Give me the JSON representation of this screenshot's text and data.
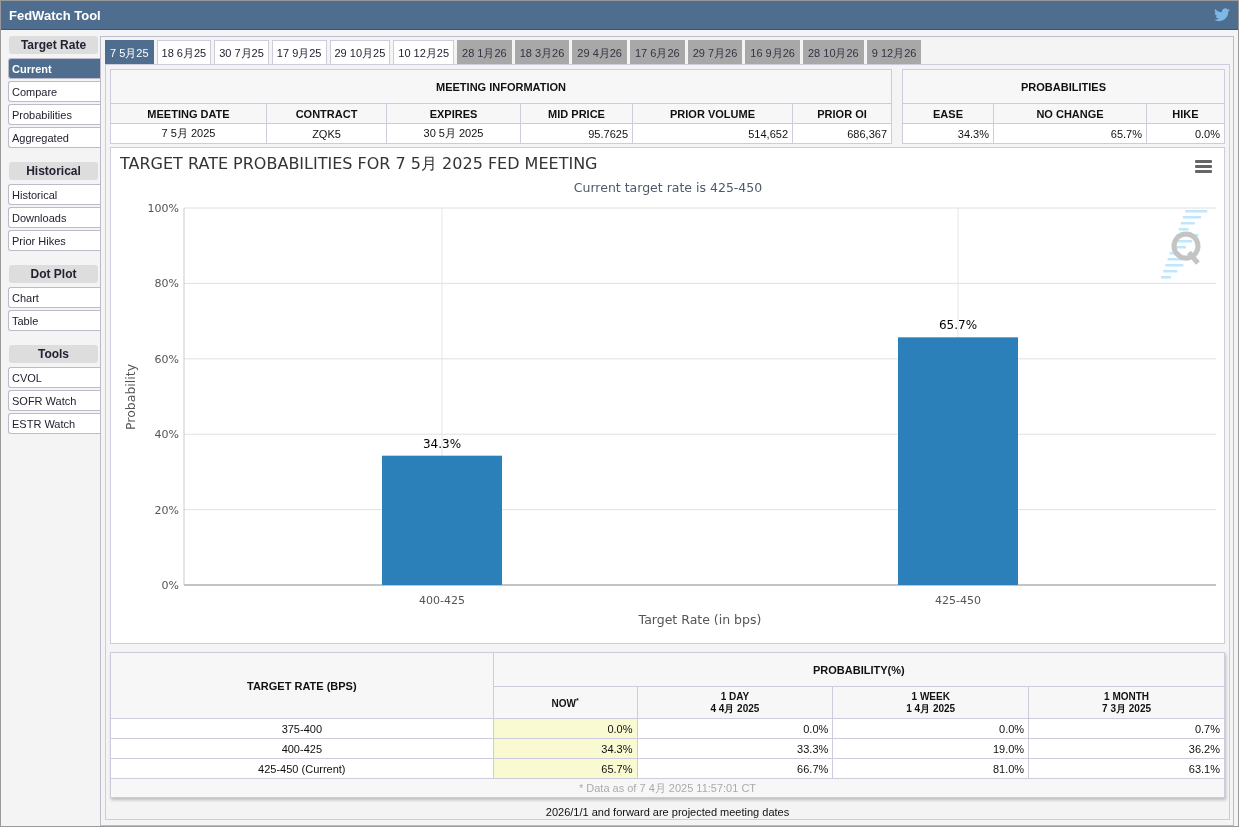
{
  "window": {
    "title": "FedWatch Tool"
  },
  "sidebar": [
    {
      "heading": "Target Rate",
      "items": [
        {
          "label": "Current",
          "selected": true
        },
        {
          "label": "Compare",
          "selected": false
        },
        {
          "label": "Probabilities",
          "selected": false
        },
        {
          "label": "Aggregated",
          "selected": false
        }
      ]
    },
    {
      "heading": "Historical",
      "items": [
        {
          "label": "Historical",
          "selected": false
        },
        {
          "label": "Downloads",
          "selected": false
        },
        {
          "label": "Prior Hikes",
          "selected": false
        }
      ]
    },
    {
      "heading": "Dot Plot",
      "items": [
        {
          "label": "Chart",
          "selected": false
        },
        {
          "label": "Table",
          "selected": false
        }
      ]
    },
    {
      "heading": "Tools",
      "items": [
        {
          "label": "CVOL",
          "selected": false
        },
        {
          "label": "SOFR Watch",
          "selected": false
        },
        {
          "label": "ESTR Watch",
          "selected": false
        }
      ]
    }
  ],
  "tabs": [
    {
      "label": "7 5月25",
      "selected": true,
      "projected": false
    },
    {
      "label": "18 6月25",
      "selected": false,
      "projected": false
    },
    {
      "label": "30 7月25",
      "selected": false,
      "projected": false
    },
    {
      "label": "17 9月25",
      "selected": false,
      "projected": false
    },
    {
      "label": "29 10月25",
      "selected": false,
      "projected": false
    },
    {
      "label": "10 12月25",
      "selected": false,
      "projected": false
    },
    {
      "label": "28 1月26",
      "selected": false,
      "projected": true
    },
    {
      "label": "18 3月26",
      "selected": false,
      "projected": true
    },
    {
      "label": "29 4月26",
      "selected": false,
      "projected": true
    },
    {
      "label": "17 6月26",
      "selected": false,
      "projected": true
    },
    {
      "label": "29 7月26",
      "selected": false,
      "projected": true
    },
    {
      "label": "16 9月26",
      "selected": false,
      "projected": true
    },
    {
      "label": "28 10月26",
      "selected": false,
      "projected": true
    },
    {
      "label": "9 12月26",
      "selected": false,
      "projected": true
    }
  ],
  "meeting_information": {
    "title": "MEETING INFORMATION",
    "columns": [
      "MEETING DATE",
      "CONTRACT",
      "EXPIRES",
      "MID PRICE",
      "PRIOR VOLUME",
      "PRIOR OI"
    ],
    "values": [
      "7 5月 2025",
      "ZQK5",
      "30 5月 2025",
      "95.7625",
      "514,652",
      "686,367"
    ]
  },
  "probabilities": {
    "title": "PROBABILITIES",
    "columns": [
      "EASE",
      "NO CHANGE",
      "HIKE"
    ],
    "values": [
      "34.3%",
      "65.7%",
      "0.0%"
    ]
  },
  "chart": {
    "subtitle": "Current target rate is 425-450",
    "chart_data": {
      "type": "bar",
      "title": "TARGET RATE PROBABILITIES FOR 7 5月 2025 FED MEETING",
      "xlabel": "Target Rate (in bps)",
      "ylabel": "Probability",
      "categories": [
        "400-425",
        "425-450"
      ],
      "values": [
        34.3,
        65.7
      ],
      "ylim": [
        0,
        100
      ],
      "yticks": [
        {
          "value": 0,
          "label": "0%"
        },
        {
          "value": 20,
          "label": "20%"
        },
        {
          "value": 40,
          "label": "40%"
        },
        {
          "value": 60,
          "label": "60%"
        },
        {
          "value": 80,
          "label": "80%"
        },
        {
          "value": 100,
          "label": "100%"
        }
      ],
      "value_labels": [
        "34.3%",
        "65.7%"
      ],
      "grid": true
    }
  },
  "probability_table": {
    "first_column": "TARGET RATE (BPS)",
    "group_title": "PROBABILITY(%)",
    "columns": [
      {
        "title": "NOW$^{*}$",
        "highlight": true
      },
      {
        "title": "1 DAY",
        "date": "4 4月 2025",
        "highlight": false
      },
      {
        "title": "1 WEEK",
        "date": "1 4月 2025",
        "highlight": false
      },
      {
        "title": "1 MONTH",
        "date": "7 3月 2025",
        "highlight": false
      }
    ],
    "rows": [
      {
        "rate": "375-400",
        "values": [
          "0.0%",
          "0.0%",
          "0.0%",
          "0.7%"
        ]
      },
      {
        "rate": "400-425",
        "values": [
          "34.3%",
          "33.3%",
          "19.0%",
          "36.2%"
        ]
      },
      {
        "rate": "425-450 (Current)",
        "values": [
          "65.7%",
          "66.7%",
          "81.0%",
          "63.1%"
        ]
      }
    ],
    "footnote": "* Data as of 7 4月 2025 11:57:01 CT"
  },
  "note": "2026/1/1 and forward are projected meeting dates"
}
